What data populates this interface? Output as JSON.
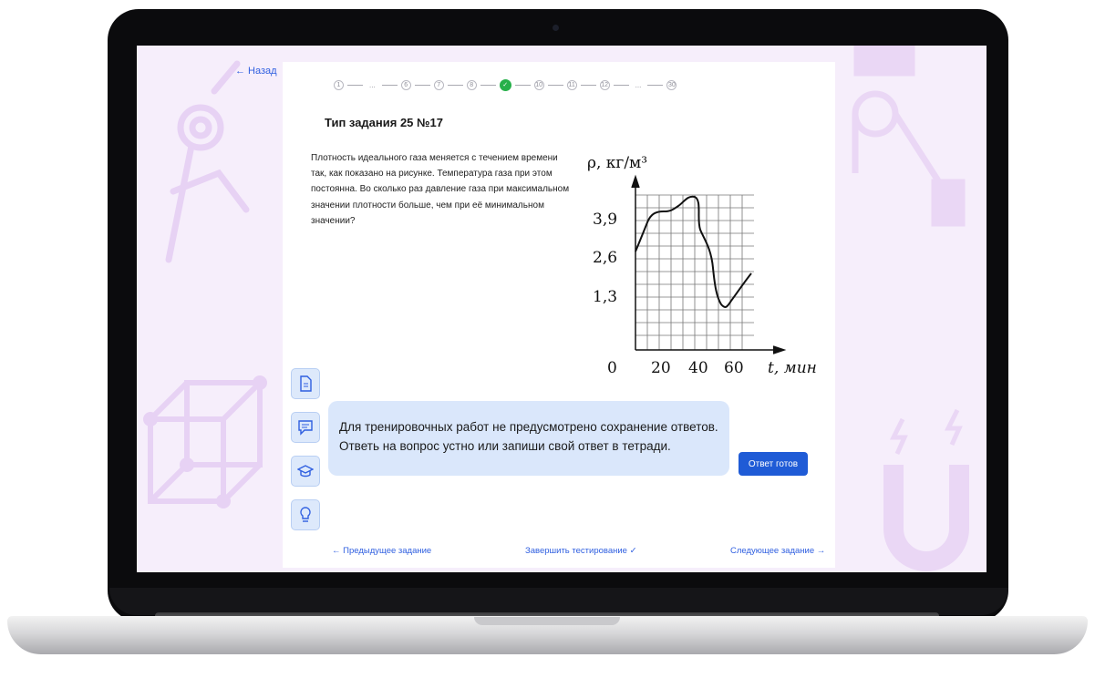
{
  "nav": {
    "back_label": "← Назад",
    "prev_label": "← Предыдущее задание",
    "finish_label": "Завершить тестирование ✓",
    "next_label": "Следующее задание →"
  },
  "progress": {
    "steps": [
      {
        "label": "1"
      },
      {
        "label": "..."
      },
      {
        "label": "6"
      },
      {
        "label": "7"
      },
      {
        "label": "8"
      },
      {
        "label": "✓",
        "state": "done"
      },
      {
        "label": "10"
      },
      {
        "label": "11"
      },
      {
        "label": "12"
      },
      {
        "label": "..."
      },
      {
        "label": "30"
      }
    ]
  },
  "task": {
    "title": "Тип задания 25 №17",
    "text": "Плотность идеального газа меняется с течением времени так, как показано на рисунке. Температура газа при этом постоянна. Во сколько раз давление газа при максимальном значении плотности больше, чем при её минимальном значении?"
  },
  "figure": {
    "y_axis_label": "ρ, кг/м³",
    "x_axis_label": "t, мин",
    "y_ticks": [
      "3,9",
      "2,6",
      "1,3"
    ],
    "x_ticks": [
      "0",
      "20",
      "40",
      "60"
    ]
  },
  "notice": {
    "text": "Для тренировочных работ не предусмотрено сохранение ответов. Ответь на вопрос устно или запиши свой ответ в тетради.",
    "button_label": "Ответ готов"
  },
  "tools": [
    "document-icon",
    "chat-icon",
    "graduation-cap-icon",
    "lightbulb-icon"
  ],
  "colors": {
    "accent": "#1f5bd6",
    "link": "#2f5fe0",
    "done": "#27b04a",
    "notice_bg": "#dae7fb",
    "screen_bg": "#f6eefb"
  }
}
